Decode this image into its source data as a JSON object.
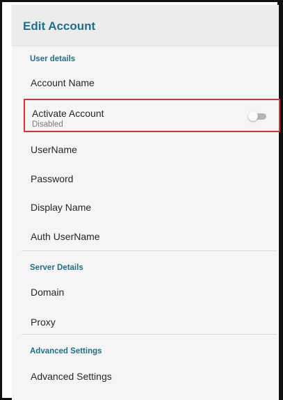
{
  "header": {
    "title": "Edit Account"
  },
  "sections": {
    "user_details": {
      "title": "User details",
      "items": [
        "Account Name",
        "UserName",
        "Password",
        "Display Name",
        "Auth UserName"
      ],
      "activate": {
        "label": "Activate Account",
        "status": "Disabled",
        "enabled": false
      }
    },
    "server_details": {
      "title": "Server Details",
      "items": [
        "Domain",
        "Proxy"
      ]
    },
    "advanced": {
      "title": "Advanced Settings",
      "items": [
        "Advanced Settings"
      ]
    }
  },
  "colors": {
    "accent": "#1f6f86",
    "highlight_border": "#d6313c",
    "background": "#f5f5f5"
  }
}
